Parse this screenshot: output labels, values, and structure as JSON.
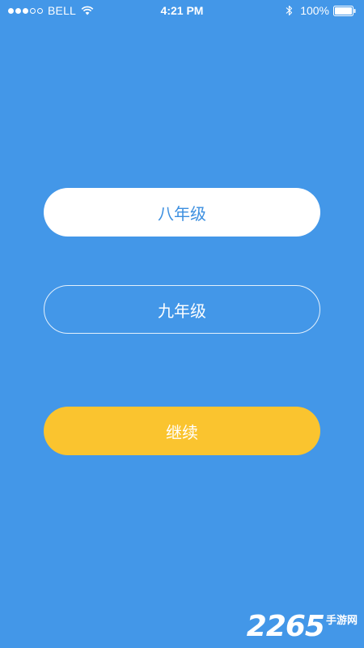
{
  "status_bar": {
    "signal_filled": 3,
    "signal_total": 5,
    "carrier": "BELL",
    "time": "4:21 PM",
    "battery_percent": "100%"
  },
  "options": {
    "grade_8": "八年级",
    "grade_9": "九年级"
  },
  "continue_label": "继续",
  "watermark": {
    "number": "2265",
    "text": "手游网"
  },
  "colors": {
    "background": "#4397E8",
    "selected_text": "#3C8FE0",
    "continue_button": "#FAC42F"
  }
}
